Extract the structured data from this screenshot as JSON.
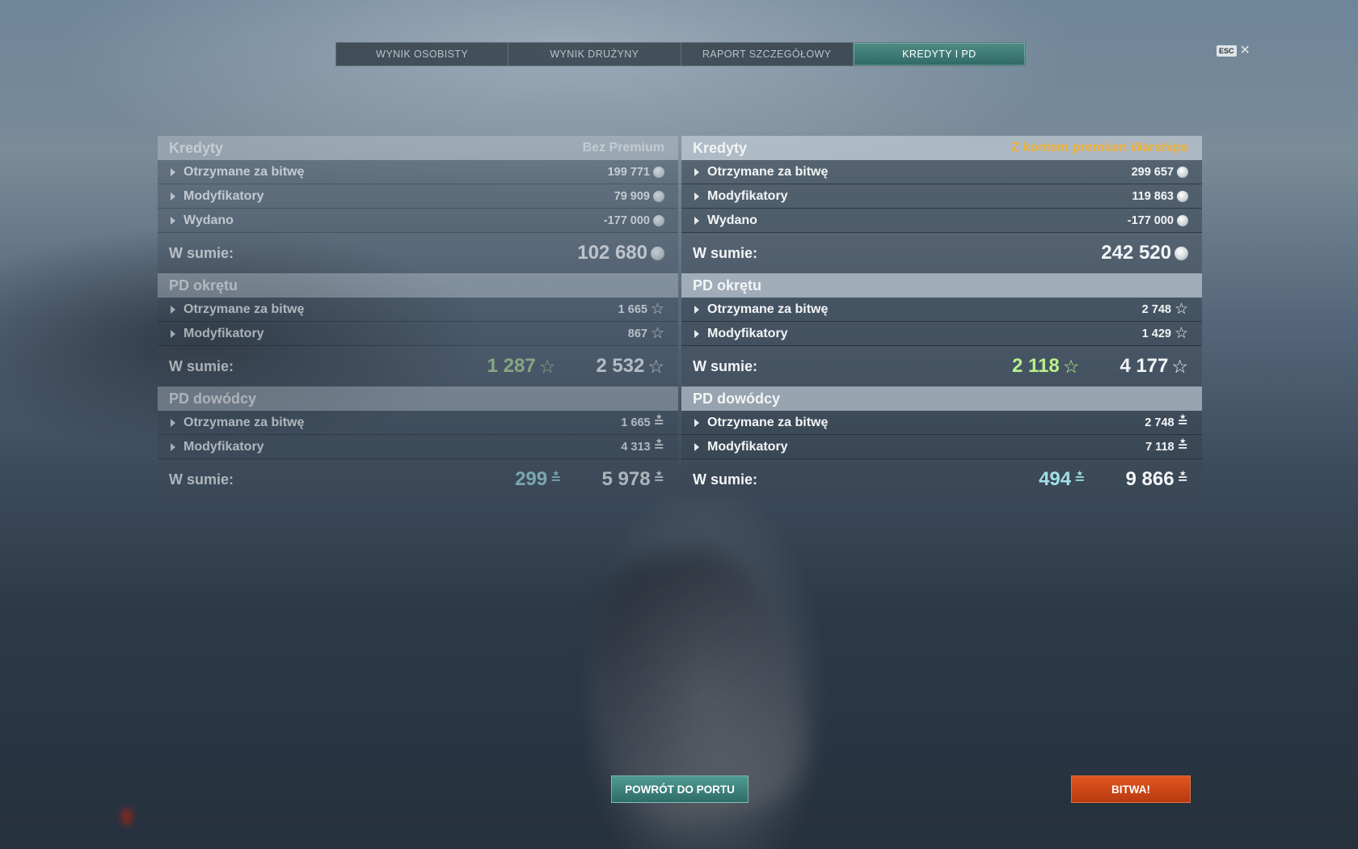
{
  "tabs": [
    {
      "label": "WYNIK OSOBISTY"
    },
    {
      "label": "WYNIK DRUŻYNY"
    },
    {
      "label": "RAPORT SZCZEGÓŁOWY"
    },
    {
      "label": "KREDYTY I PD"
    }
  ],
  "esc": {
    "key": "ESC",
    "close": "✕"
  },
  "left": {
    "account_label": "Bez Premium",
    "credits": {
      "title": "Kredyty",
      "rows": [
        {
          "label": "Otrzymane za bitwę",
          "value": "199 771"
        },
        {
          "label": "Modyfikatory",
          "value": "79 909"
        },
        {
          "label": "Wydano",
          "value": "-177 000"
        }
      ],
      "total_label": "W sumie:",
      "total": "102 680"
    },
    "ship_xp": {
      "title": "PD okrętu",
      "rows": [
        {
          "label": "Otrzymane za bitwę",
          "value": "1 665"
        },
        {
          "label": "Modyfikatory",
          "value": "867"
        }
      ],
      "total_label": "W sumie:",
      "elite": "1 287",
      "total": "2 532"
    },
    "commander_xp": {
      "title": "PD dowódcy",
      "rows": [
        {
          "label": "Otrzymane za bitwę",
          "value": "1 665"
        },
        {
          "label": "Modyfikatory",
          "value": "4 313"
        }
      ],
      "total_label": "W sumie:",
      "elite": "299",
      "total": "5 978"
    }
  },
  "right": {
    "account_label": "Z kontem premium Warships",
    "credits": {
      "title": "Kredyty",
      "rows": [
        {
          "label": "Otrzymane za bitwę",
          "value": "299 657"
        },
        {
          "label": "Modyfikatory",
          "value": "119 863"
        },
        {
          "label": "Wydano",
          "value": "-177 000"
        }
      ],
      "total_label": "W sumie:",
      "total": "242 520"
    },
    "ship_xp": {
      "title": "PD okrętu",
      "rows": [
        {
          "label": "Otrzymane za bitwę",
          "value": "2 748"
        },
        {
          "label": "Modyfikatory",
          "value": "1 429"
        }
      ],
      "total_label": "W sumie:",
      "elite": "2 118",
      "total": "4 177"
    },
    "commander_xp": {
      "title": "PD dowódcy",
      "rows": [
        {
          "label": "Otrzymane za bitwę",
          "value": "2 748"
        },
        {
          "label": "Modyfikatory",
          "value": "7 118"
        }
      ],
      "total_label": "W sumie:",
      "elite": "494",
      "total": "9 866"
    }
  },
  "buttons": {
    "port": "POWRÓT DO PORTU",
    "battle": "BITWA!"
  },
  "icons": {
    "credit": "credit-coin-icon",
    "xp": "star-icon",
    "commander": "commander-xp-icon"
  },
  "colors": {
    "active_tab": "#3f7d78",
    "premium": "#f3b236",
    "battle": "#c9441a",
    "elite_ship": "#b8f08a",
    "elite_commander": "#9fe0e6"
  }
}
